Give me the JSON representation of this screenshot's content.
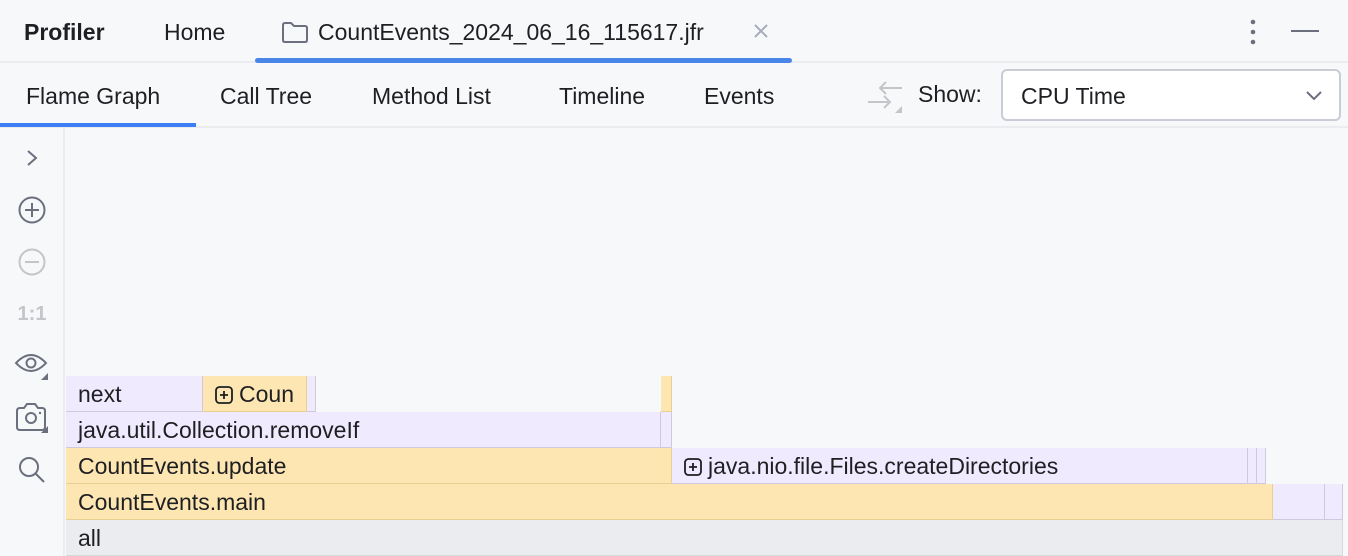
{
  "topbar": {
    "title": "Profiler",
    "home_tab": "Home",
    "file_tab": {
      "icon": "folder-icon",
      "label": "CountEvents_2024_06_16_115617.jfr",
      "close_icon": "close-icon",
      "active": true
    },
    "more_icon": "kebab-menu-icon",
    "minimize_icon": "minimize-icon"
  },
  "subtabs": {
    "items": [
      {
        "label": "Flame Graph",
        "active": true
      },
      {
        "label": "Call Tree",
        "active": false
      },
      {
        "label": "Method List",
        "active": false
      },
      {
        "label": "Timeline",
        "active": false
      },
      {
        "label": "Events",
        "active": false
      }
    ],
    "toggle_icon": "compare-arrows-icon",
    "show_label": "Show:",
    "show_value": "CPU Time"
  },
  "left_toolbar": {
    "items": [
      {
        "icon": "chevron-right-icon",
        "enabled": true
      },
      {
        "icon": "zoom-in-icon",
        "enabled": true
      },
      {
        "icon": "zoom-out-icon",
        "enabled": false
      },
      {
        "icon": "actual-size-icon",
        "text": "1:1",
        "enabled": false
      },
      {
        "icon": "eye-icon",
        "enabled": true
      },
      {
        "icon": "camera-icon",
        "enabled": true
      },
      {
        "icon": "search-icon",
        "enabled": true
      }
    ]
  },
  "flame_graph": {
    "colors": {
      "project": "#fde6b2",
      "library": "#f0eafe",
      "root": "#ebecf0"
    },
    "rows": [
      [
        {
          "label": "next",
          "kind": "library",
          "expandable": false
        },
        {
          "label": "Coun",
          "kind": "project",
          "expandable": true
        },
        {
          "label": "",
          "kind": "library",
          "expandable": false
        },
        {
          "label": "",
          "kind": "project",
          "expandable": false
        }
      ],
      [
        {
          "label": "java.util.Collection.removeIf",
          "kind": "library",
          "expandable": false
        },
        {
          "label": "",
          "kind": "library",
          "expandable": false
        }
      ],
      [
        {
          "label": "CountEvents.update",
          "kind": "project",
          "expandable": false
        },
        {
          "label": "java.nio.file.Files.createDirectories",
          "kind": "library",
          "expandable": true
        },
        {
          "label": "",
          "kind": "library",
          "expandable": false
        },
        {
          "label": "",
          "kind": "library",
          "expandable": false
        }
      ],
      [
        {
          "label": "CountEvents.main",
          "kind": "project",
          "expandable": false
        },
        {
          "label": "",
          "kind": "library",
          "expandable": false
        },
        {
          "label": "",
          "kind": "library",
          "expandable": false
        }
      ],
      [
        {
          "label": "all",
          "kind": "root",
          "expandable": false
        }
      ]
    ]
  }
}
